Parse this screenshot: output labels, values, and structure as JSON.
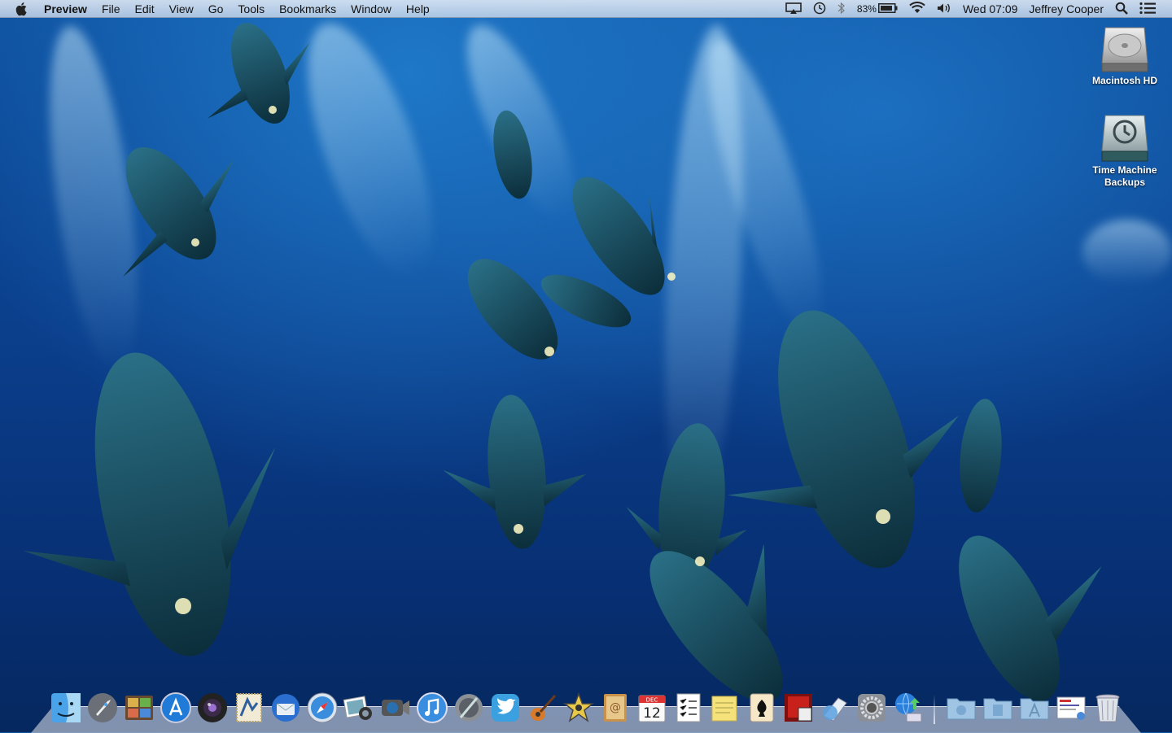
{
  "menubar": {
    "app_name": "Preview",
    "menus": [
      "File",
      "Edit",
      "View",
      "Go",
      "Tools",
      "Bookmarks",
      "Window",
      "Help"
    ],
    "status": {
      "battery_percent": "83%",
      "clock": "Wed 07:09",
      "user": "Jeffrey Cooper"
    }
  },
  "desktop": {
    "icons": [
      {
        "label": "Macintosh HD",
        "icon": "hard-drive-icon"
      },
      {
        "label": "Time Machine\nBackups",
        "icon": "time-machine-drive-icon"
      }
    ]
  },
  "dock": {
    "apps": [
      "finder-icon",
      "launchpad-icon",
      "photo-booth-icon",
      "app-store-icon",
      "camera-icon",
      "mail-stamp-icon",
      "thunderbird-icon",
      "safari-icon",
      "iphoto-icon",
      "facetime-icon",
      "itunes-icon",
      "script-editor-icon",
      "twitter-icon",
      "garageband-icon",
      "imovie-icon",
      "address-book-icon",
      "calendar-icon",
      "reminders-icon",
      "stickies-icon",
      "solitaire-icon",
      "photo-theater-icon",
      "preview-icon",
      "system-preferences-icon",
      "network-utility-icon"
    ],
    "calendar_date": "12",
    "calendar_month": "DEC",
    "stacks": [
      "downloads-folder-icon",
      "documents-folder-icon",
      "applications-folder-icon",
      "mail-document-icon",
      "trash-icon"
    ]
  }
}
